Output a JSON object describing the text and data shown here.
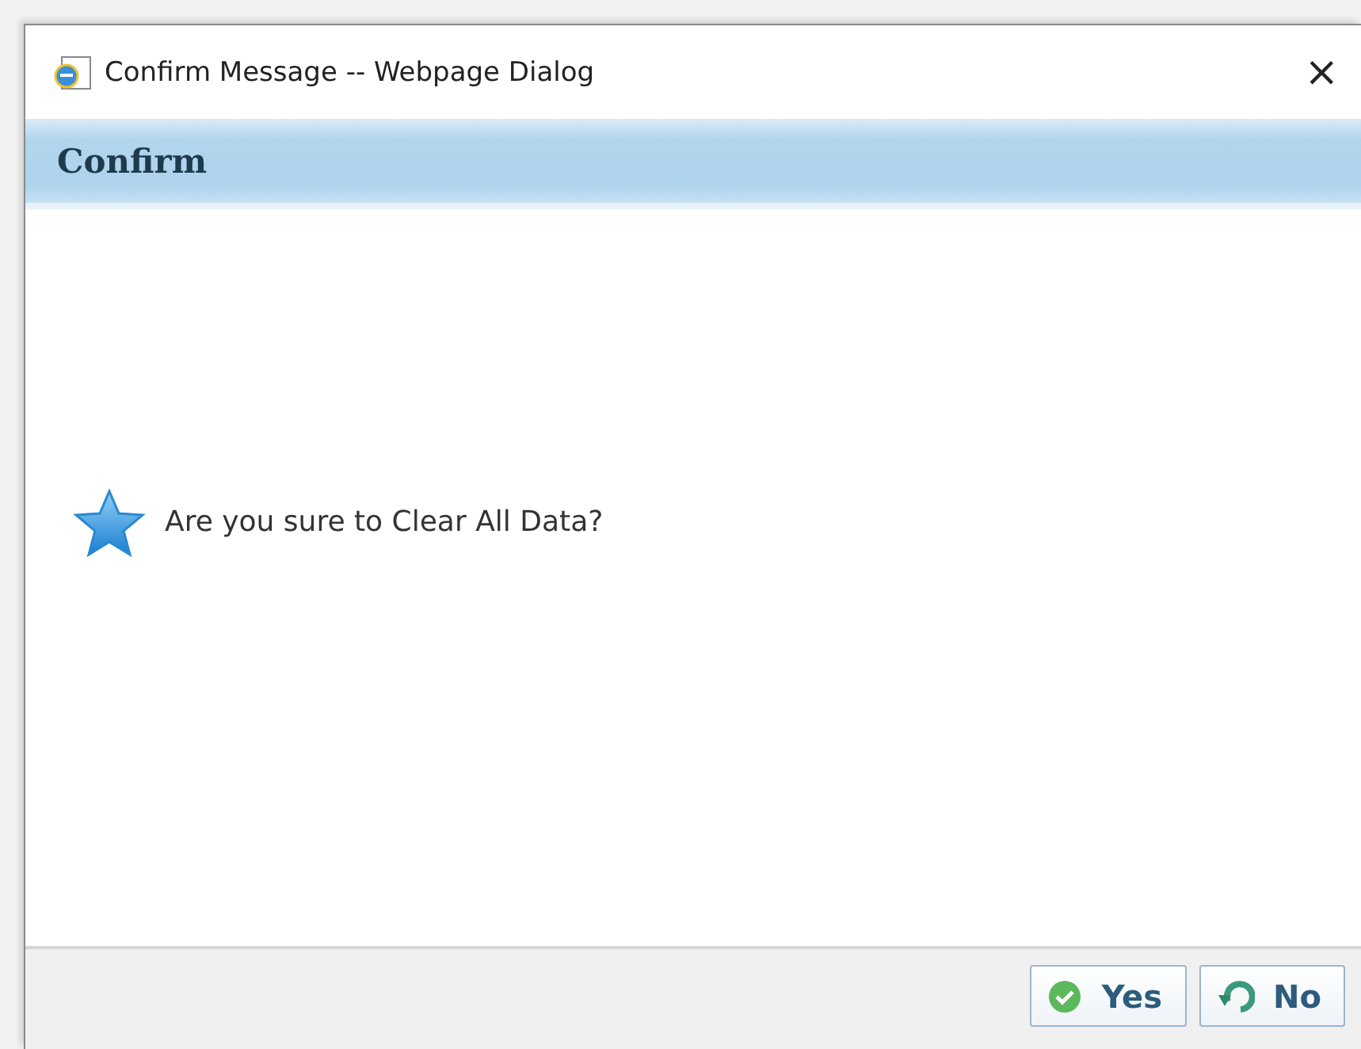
{
  "window": {
    "title": "Confirm Message -- Webpage Dialog",
    "close": "×"
  },
  "header": {
    "title": "Confirm"
  },
  "message": {
    "text": "Are you sure to Clear All Data?"
  },
  "buttons": [
    {
      "label": "Yes",
      "kind": "yes"
    },
    {
      "label": "No",
      "kind": "no"
    }
  ]
}
